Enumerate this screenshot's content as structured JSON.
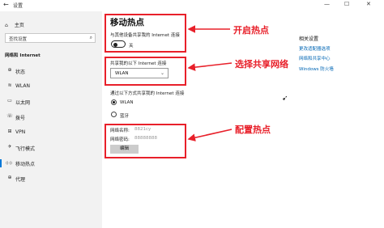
{
  "window": {
    "back": "←",
    "title": "设置",
    "minimize": "—",
    "maximize": "☐",
    "close": "✕"
  },
  "sidebar": {
    "home_label": "主页",
    "search_placeholder": "查找设置",
    "section": "网络和 Internet",
    "items": [
      {
        "icon": "⊕",
        "label": "状态",
        "icon_name": "globe-icon"
      },
      {
        "icon": "≋",
        "label": "WLAN",
        "icon_name": "wifi-icon"
      },
      {
        "icon": "▭",
        "label": "以太网",
        "icon_name": "ethernet-icon"
      },
      {
        "icon": "☏",
        "label": "拨号",
        "icon_name": "dialup-icon"
      },
      {
        "icon": "⊞",
        "label": "VPN",
        "icon_name": "vpn-icon"
      },
      {
        "icon": "✈",
        "label": "飞行模式",
        "icon_name": "airplane-icon"
      },
      {
        "icon": "((·))",
        "label": "移动热点",
        "icon_name": "hotspot-icon",
        "active": true
      },
      {
        "icon": "⊕",
        "label": "代理",
        "icon_name": "proxy-icon"
      }
    ]
  },
  "main": {
    "title": "移动热点",
    "share_desc": "与其他设备共享我的 Internet 连接",
    "toggle_state": "关",
    "share_from_label": "共享我的以下 Internet 连接",
    "share_from_value": "WLAN",
    "share_over_label": "通过以下方式共享我的 Internet 连接",
    "radio_options": [
      {
        "label": "WLAN",
        "checked": true
      },
      {
        "label": "蓝牙",
        "checked": false
      }
    ],
    "network_name_label": "网络名称:",
    "network_name_value": "8821cy",
    "network_password_label": "网络密码:",
    "network_password_value": "88888888",
    "edit_button": "编辑"
  },
  "related": {
    "heading": "相关设置",
    "links": [
      "更改适配器选项",
      "网络和共享中心",
      "Windows 防火墙"
    ]
  },
  "annotations": {
    "label_1": "开启热点",
    "label_2": "选择共享网络",
    "label_3": "配置热点",
    "color": "#e8202a"
  },
  "colors": {
    "accent": "#0078d7",
    "link": "#0066b4",
    "sidebar_bg": "#f2f2f2"
  }
}
